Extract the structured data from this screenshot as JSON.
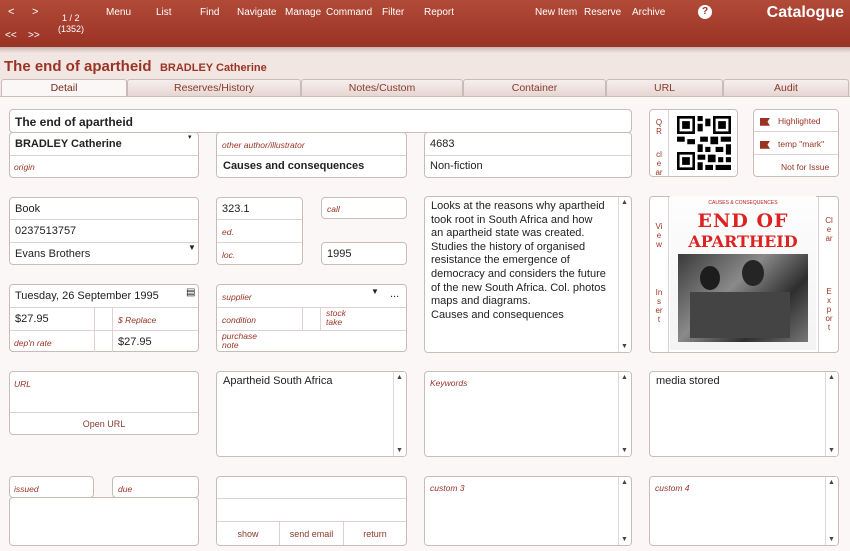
{
  "toolbar": {
    "prev": "<",
    "next": ">",
    "first": "<<",
    "last": ">>",
    "record_pos": "1 / 2",
    "record_total": "(1352)",
    "menu": "Menu",
    "list": "List",
    "find": "Find",
    "navigate": "Navigate",
    "manage": "Manage",
    "command": "Command",
    "filter": "Filter",
    "report": "Report",
    "new_item": "New Item",
    "reserve": "Reserve",
    "archive": "Archive",
    "help": "?",
    "brand": "Catalogue"
  },
  "record": {
    "title": "The end of apartheid",
    "author": "BRADLEY  Catherine"
  },
  "tabs": [
    "Detail",
    "Reserves/History",
    "Notes/Custom",
    "Container",
    "URL",
    "Audit"
  ],
  "detail": {
    "title_field": "The end of apartheid",
    "author_field": "BRADLEY  Catherine",
    "other_author_label": "other author/illustrator",
    "id_number": "4683",
    "origin_label": "origin",
    "subject": "Causes and consequences",
    "category": "Non-fiction",
    "format": "Book",
    "isbn": "0237513757",
    "publisher": "Evans Brothers",
    "dewey": "323.1",
    "call_label": "call",
    "ed_label": "ed.",
    "loc_label": "loc.",
    "year": "1995",
    "date_acquired": "Tuesday, 26 September 1995",
    "supplier_label": "supplier",
    "supplier_more": "...",
    "price": "$27.95",
    "replace_label": "$ Replace",
    "condition_label": "condition",
    "stock_take_label": "stock take",
    "depn_label": "dep'n rate",
    "replace_value": "$27.95",
    "purchase_note_label": "purchase note",
    "notes": "Looks at the reasons why apartheid\ntook root in South Africa  and how\nan apartheid state was created.\nStudies the history of organised\nresistance  the emergence of\ndemocracy and considers the future\nof the new South Africa. Col. photos\nmaps and diagrams.\nCauses and consequences",
    "qr_label": "QR",
    "clear_label": "clear",
    "highlighted": "Highlighted",
    "temp_mark": "temp \"mark\"",
    "not_for_issue": "Not for Issue",
    "view_label": "View",
    "insert_label": "Insert",
    "clear_img_label": "Clear",
    "export_label": "Export",
    "cover_series": "CAUSES & CONSEQUENCES",
    "cover_title_1": "END OF",
    "cover_title_2": "APARTHEID",
    "url_label": "URL",
    "open_url": "Open URL",
    "subjects_list": "Apartheid South Africa",
    "keywords_label": "Keywords",
    "media": "media stored",
    "issued_label": "issued",
    "due_label": "due",
    "show_btn": "show",
    "email_btn": "send email",
    "return_btn": "return",
    "custom3_label": "custom 3",
    "custom4_label": "custom 4"
  },
  "colors": {
    "accent": "#9a3324",
    "header": "#a93f2e",
    "panel": "#fbf7f6"
  }
}
